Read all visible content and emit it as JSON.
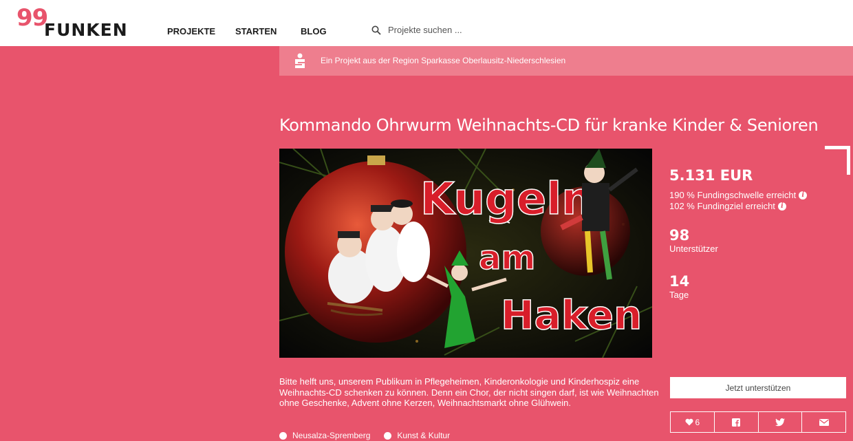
{
  "header": {
    "logo_number": "99",
    "logo_word": "FUNKEN",
    "nav": [
      "PROJEKTE",
      "STARTEN",
      "BLOG"
    ],
    "search_placeholder": "Projekte suchen ..."
  },
  "region_banner": {
    "text": "Ein Projekt aus der Region Sparkasse Oberlausitz-Niederschlesien",
    "icon": "sparkasse-logo"
  },
  "project": {
    "title": "Kommando Ohrwurm Weihnachts-CD für kranke Kinder & Senioren",
    "image_text": [
      "Kugeln",
      "am",
      "Haken"
    ],
    "description": "Bitte helft uns, unserem Publikum in Pflegeheimen, Kinderonkologie und Kinderhospiz eine Weihnachts-CD schenken zu können. Denn ein Chor, der nicht singen darf, ist wie Weihnachten ohne Geschenke, Advent ohne Kerzen, Weihnachtsmarkt ohne Glühwein.",
    "tags": [
      {
        "label": "Neusalza-Spremberg",
        "icon": "location-icon"
      },
      {
        "label": "Kunst & Kultur",
        "icon": "category-icon"
      }
    ]
  },
  "stats": {
    "amount": "5.131 EUR",
    "threshold": "190 % Fundingschwelle erreicht",
    "goal": "102 % Fundingziel erreicht",
    "supporters_count": "98",
    "supporters_label": "Unterstützer",
    "days_count": "14",
    "days_label": "Tage"
  },
  "actions": {
    "support_button": "Jetzt unterstützen",
    "likes": "6",
    "share_icons": [
      "heart-icon",
      "facebook-icon",
      "twitter-icon",
      "mail-icon"
    ]
  },
  "colors": {
    "brand": "#e8546c",
    "banner": "#ee7e8e",
    "header_bg": "#ffffff"
  }
}
